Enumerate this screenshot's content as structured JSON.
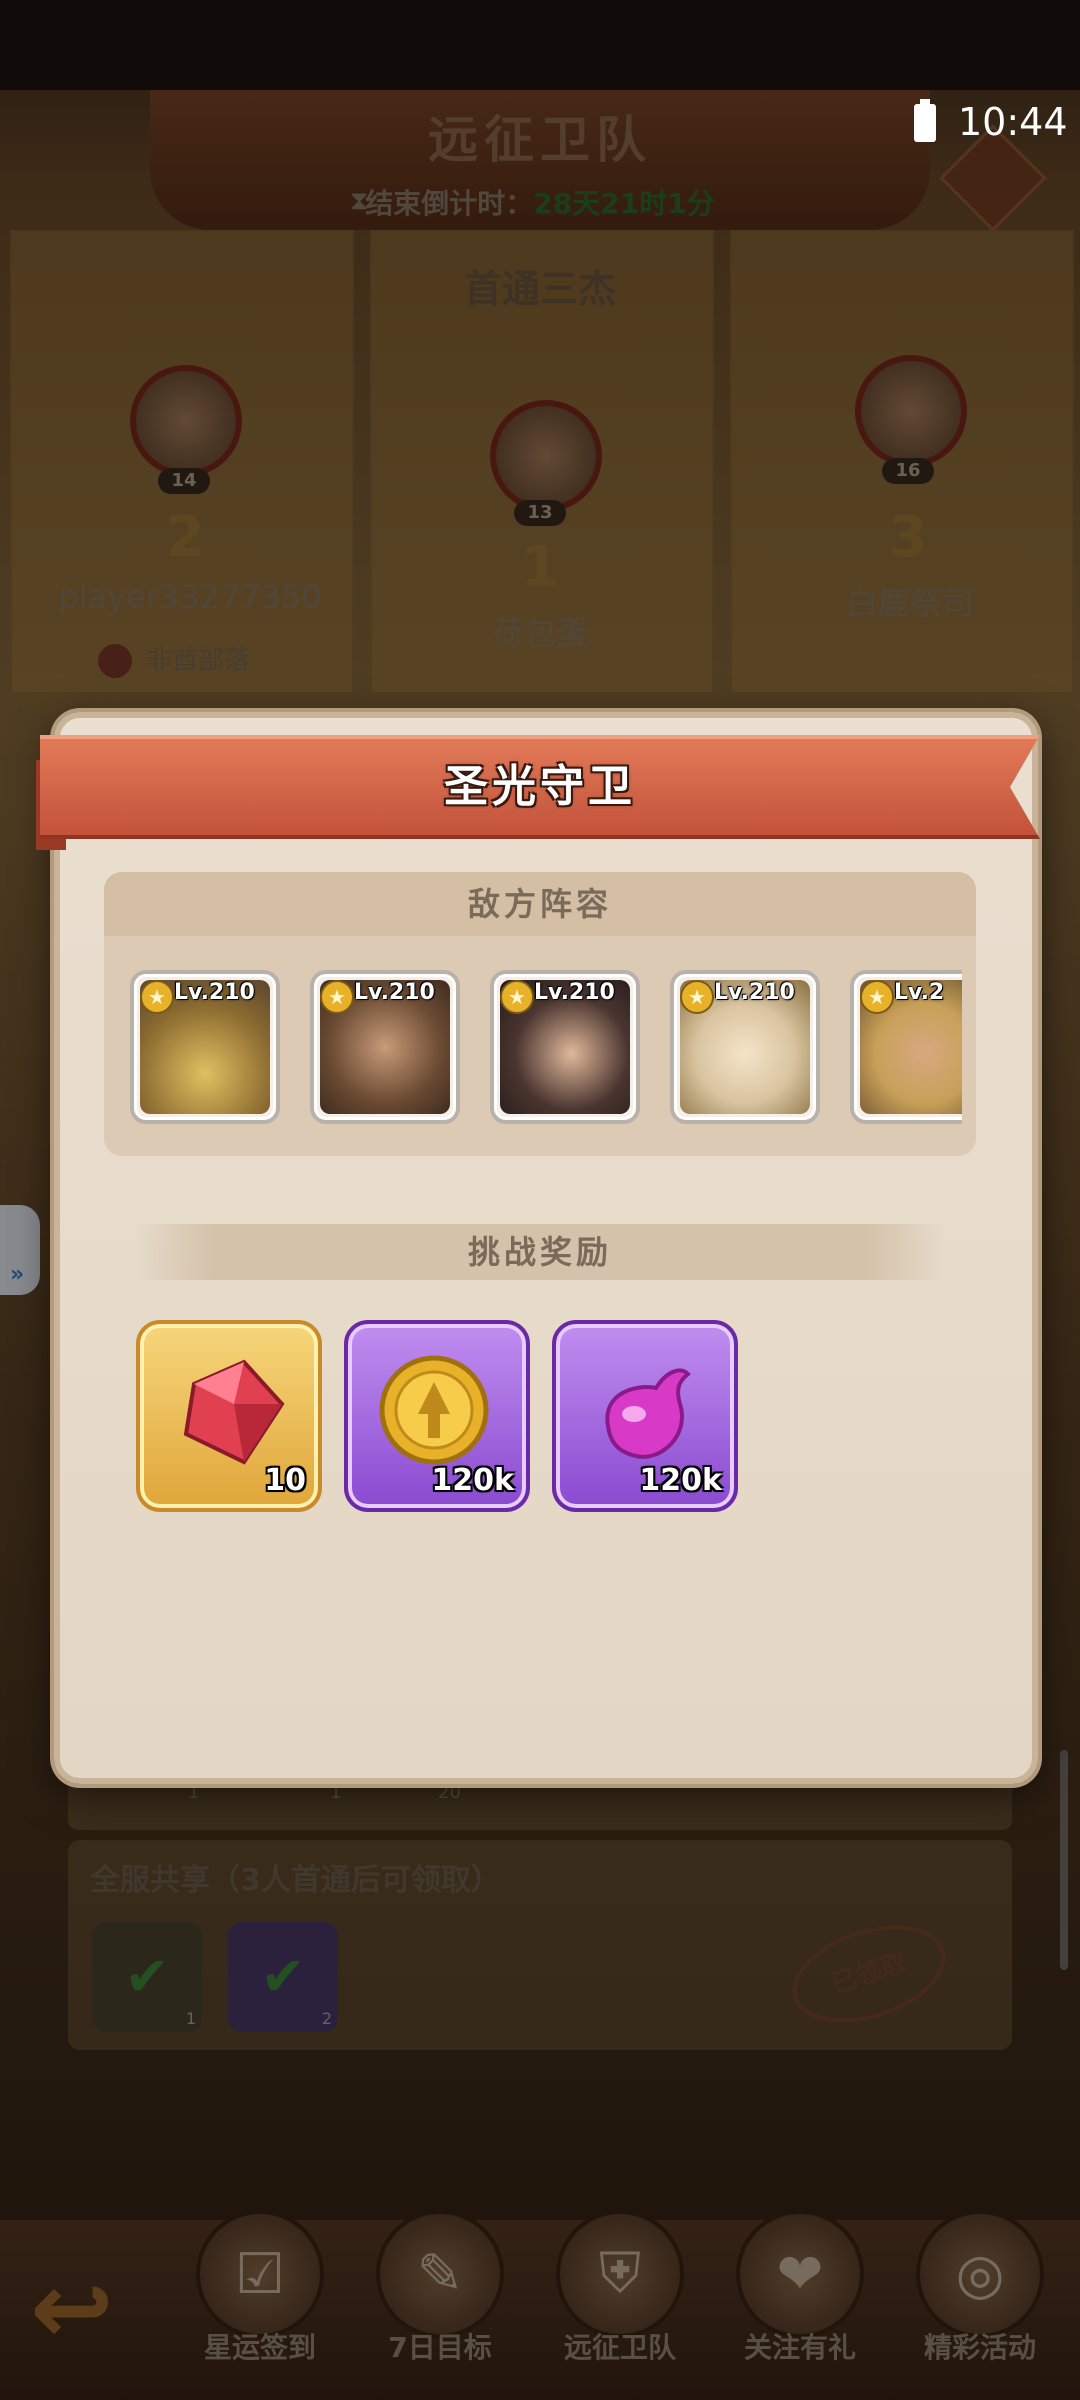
{
  "status_bar": {
    "time": "10:44"
  },
  "background": {
    "title": "远征卫队",
    "countdown_label": "结束倒计时：",
    "countdown_value": "28天21时1分",
    "subtitle": "首通三杰",
    "players": [
      {
        "rank": "2",
        "level": "14",
        "name": "player33277350",
        "tribe": "非酋部落"
      },
      {
        "rank": "1",
        "level": "13",
        "name": "荷包蛋"
      },
      {
        "rank": "3",
        "level": "16",
        "name": "白鹿祭司"
      }
    ],
    "share_title": "全服共享（3人首通后可领取）",
    "share_items": [
      {
        "count": "1"
      },
      {
        "count": "2"
      }
    ],
    "lower_counts": [
      "1",
      "1",
      "20"
    ],
    "stamp": "已领取",
    "nav": [
      {
        "label": "星运签到",
        "icon": "calendar-check-icon"
      },
      {
        "label": "7日目标",
        "icon": "notepad-icon"
      },
      {
        "label": "远征卫队",
        "icon": "shield-icon"
      },
      {
        "label": "关注有礼",
        "icon": "gift-icon"
      },
      {
        "label": "精彩活动",
        "icon": "drum-icon"
      }
    ]
  },
  "modal": {
    "title": "圣光守卫",
    "enemy_header": "敌方阵容",
    "heroes": [
      {
        "level": "Lv.210",
        "color": "#c9a040"
      },
      {
        "level": "Lv.210",
        "color": "#8a6a4a"
      },
      {
        "level": "Lv.210",
        "color": "#4a3530"
      },
      {
        "level": "Lv.210",
        "color": "#e0d6c8"
      },
      {
        "level": "Lv.2",
        "color": "#c8a058"
      }
    ],
    "reward_header": "挑战奖励",
    "rewards": [
      {
        "item": "ruby-gem",
        "quantity": "10",
        "rarity_color": "#e0a63a"
      },
      {
        "item": "gold-coin",
        "quantity": "120k",
        "rarity_color": "#8a4ad0"
      },
      {
        "item": "purple-elixir",
        "quantity": "120k",
        "rarity_color": "#8a4ad0"
      }
    ]
  }
}
